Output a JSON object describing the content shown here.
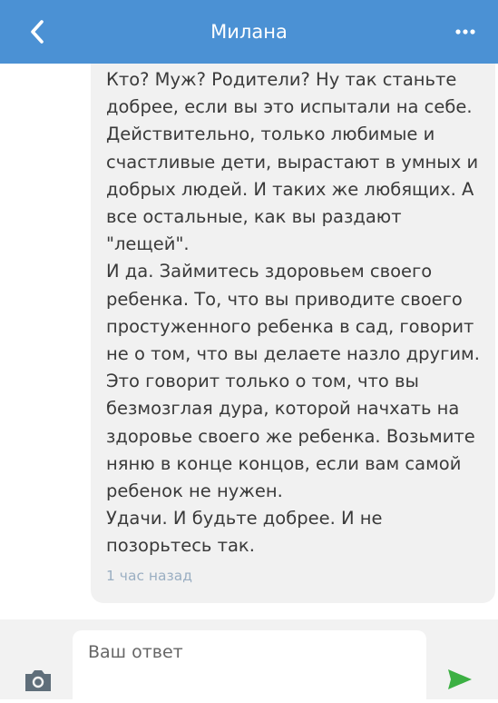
{
  "header": {
    "title": "Милана",
    "back_icon": "chevron-left-icon",
    "more_icon": "more-horizontal-icon",
    "background": "#4b91d4"
  },
  "message": {
    "text": "Кто? Муж? Родители? Ну так станьте\nдобрее, если вы это испытали на себе.\nДействительно, только любимые и\nсчастливые дети, вырастают в умных и\nдобрых людей. И таких же любящих. А\nвсе остальные, как вы раздают\n\"лещей\".\nИ да. Займитесь здоровьем своего\nребенка. То, что вы приводите своего\nпростуженного ребенка в сад, говорит\nне о том, что вы делаете назло другим.\nЭто говорит только о том, что вы\nбезмозглая дура, которой начхать на\nздоровье своего же ребенка. Возьмите\nняню в конце концов, если вам самой\nребенок не нужен.\nУдачи. И будьте добрее. И не\nпозорьтесь так.",
    "time": "1 час назад"
  },
  "composer": {
    "placeholder": "Ваш ответ",
    "value": "",
    "camera_icon": "camera-icon",
    "send_icon": "send-icon",
    "send_color": "#3cb043"
  }
}
